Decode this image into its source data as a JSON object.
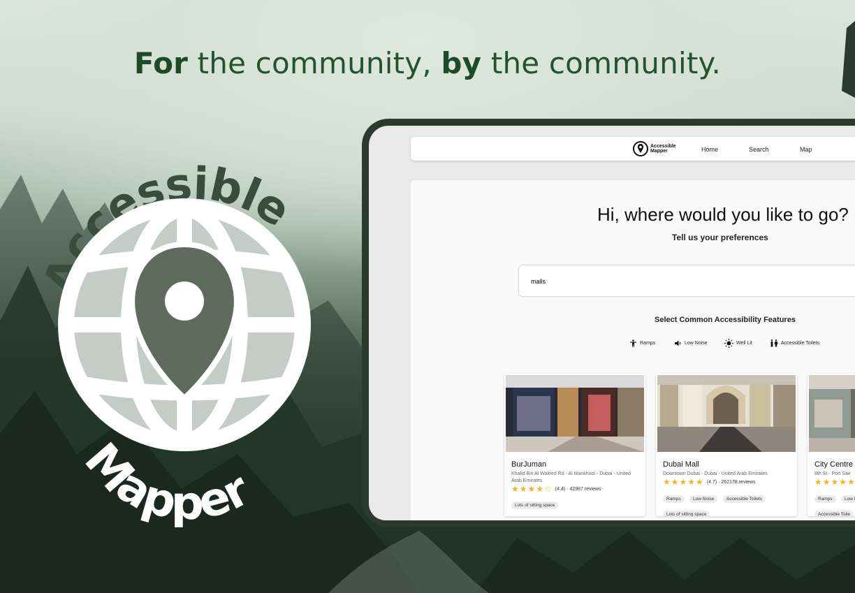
{
  "headline": {
    "bold1": "For",
    "text1": " the community, ",
    "bold2": "by",
    "text2": " the community."
  },
  "logo": {
    "top_word": "Accessible",
    "bottom_word": "Mapper"
  },
  "app": {
    "brand": {
      "line1": "Accessible",
      "line2": "Mapper"
    },
    "nav": [
      "Home",
      "Search",
      "Map"
    ],
    "greeting": "Hi, where would you like to go?",
    "subtitle": "Tell us your preferences",
    "search": {
      "value": "malls"
    },
    "features_title": "Select Common Accessibility Features",
    "features": [
      {
        "label": "Ramps",
        "icon": "ramp-person-icon"
      },
      {
        "label": "Low Noise",
        "icon": "speaker-icon"
      },
      {
        "label": "Well Lit",
        "icon": "sun-icon"
      },
      {
        "label": "Accessible Toilets",
        "icon": "toilet-icon"
      }
    ],
    "results": [
      {
        "name": "BurJuman",
        "address": "Khalid Bin Al Waleed Rd - Al Mankhool - Dubai - United Arab Emirates",
        "stars": "★★★★☆",
        "rating": "(4.4) · 42987 reviews",
        "tags": [
          "Lots of sitting space"
        ]
      },
      {
        "name": "Dubai Mall",
        "address": "Downtown Dubai - Dubai - United Arab Emirates",
        "stars": "★★★★★",
        "rating": "(4.7) · 262178 reviews",
        "tags": [
          "Ramps",
          "Low Noise",
          "Accessible Toilets",
          "Lots of sitting space"
        ]
      },
      {
        "name": "City Centre",
        "address": "8th St - Port Sae",
        "stars": "★★★★★",
        "rating": "",
        "tags": [
          "Ramps",
          "Low N",
          "Accessible Toile"
        ]
      }
    ]
  },
  "colors": {
    "brand_green": "#1f4a28",
    "logo_green": "#5f6b5c",
    "star": "#f1b61d"
  }
}
